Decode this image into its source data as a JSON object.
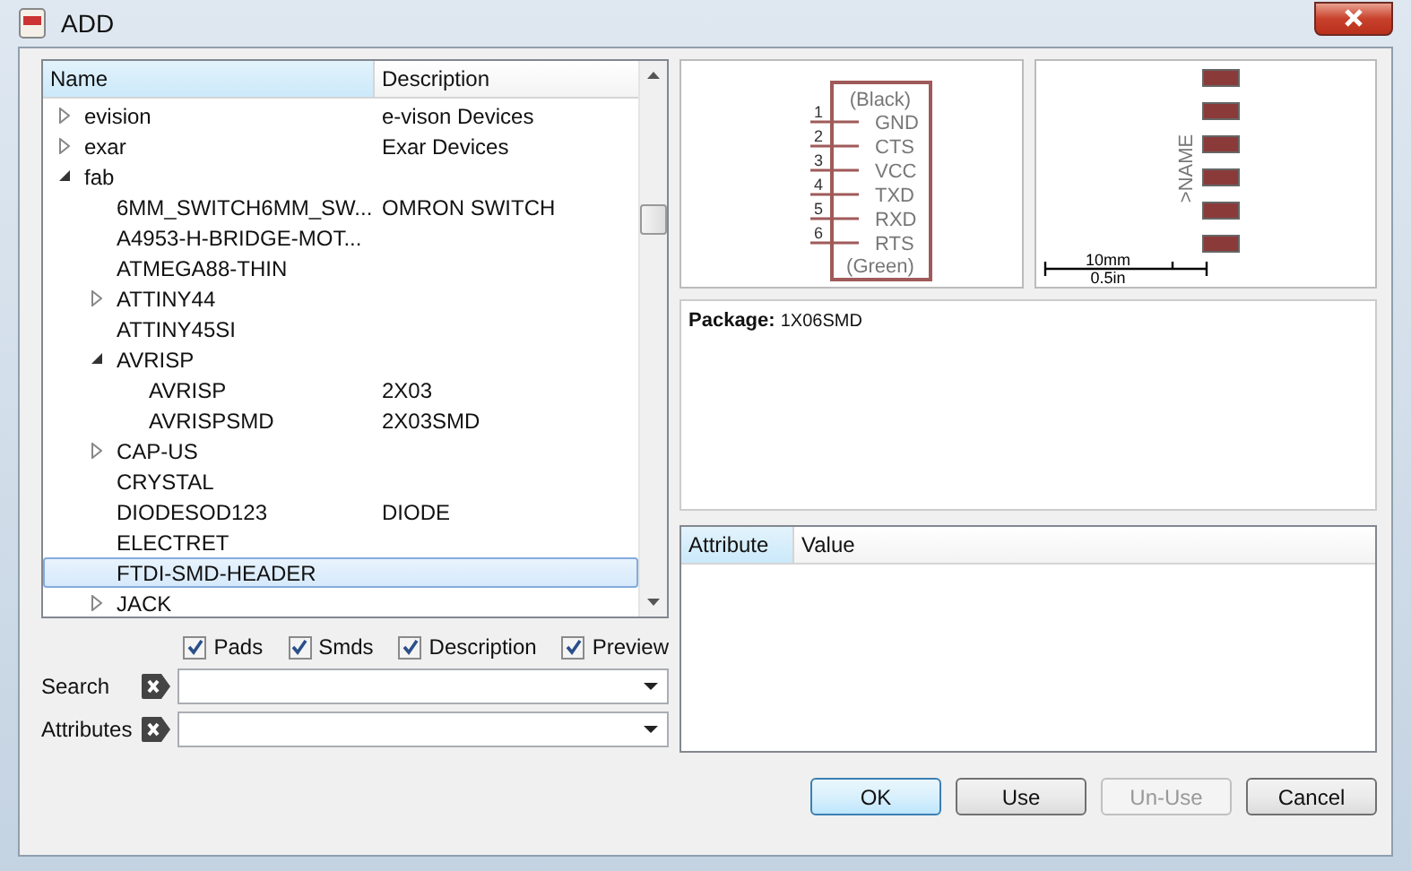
{
  "window": {
    "title": "ADD"
  },
  "tree": {
    "columns": [
      "Name",
      "Description"
    ],
    "items": [
      {
        "name": "evision",
        "description": "e-vison Devices",
        "expanded": false,
        "selected": false
      },
      {
        "name": "exar",
        "description": "Exar Devices",
        "expanded": false,
        "selected": false
      },
      {
        "name": "fab",
        "expanded": true,
        "selected": false,
        "children": [
          {
            "name": "6MM_SWITCH6MM_SW...",
            "description": "OMRON SWITCH",
            "selected": false
          },
          {
            "name": "A4953-H-BRIDGE-MOT...",
            "selected": false
          },
          {
            "name": "ATMEGA88-THIN",
            "selected": false
          },
          {
            "name": "ATTINY44",
            "expanded": false,
            "selected": false
          },
          {
            "name": "ATTINY45SI",
            "selected": false
          },
          {
            "name": "AVRISP",
            "expanded": true,
            "selected": false,
            "children": [
              {
                "name": "AVRISP",
                "description": "2X03",
                "selected": false
              },
              {
                "name": "AVRISPSMD",
                "description": "2X03SMD",
                "selected": false
              }
            ]
          },
          {
            "name": "CAP-US",
            "expanded": false,
            "selected": false
          },
          {
            "name": "CRYSTAL",
            "selected": false
          },
          {
            "name": "DIODESOD123",
            "description": "DIODE",
            "selected": false
          },
          {
            "name": "ELECTRET",
            "selected": false
          },
          {
            "name": "FTDI-SMD-HEADER",
            "selected": true
          },
          {
            "name": "JACK",
            "expanded": false,
            "selected": false
          }
        ]
      }
    ]
  },
  "filters": [
    {
      "label": "Pads",
      "checked": true
    },
    {
      "label": "Smds",
      "checked": true
    },
    {
      "label": "Description",
      "checked": true
    },
    {
      "label": "Preview",
      "checked": true
    }
  ],
  "search_fields": [
    {
      "label": "Search"
    },
    {
      "label": "Attributes"
    }
  ],
  "symbol": {
    "top_label": "(Black)",
    "bottom_label": "(Green)",
    "pins": [
      {
        "number": "1",
        "name": "GND"
      },
      {
        "number": "2",
        "name": "CTS"
      },
      {
        "number": "3",
        "name": "VCC"
      },
      {
        "number": "4",
        "name": "TXD"
      },
      {
        "number": "5",
        "name": "RXD"
      },
      {
        "number": "6",
        "name": "RTS"
      }
    ]
  },
  "package_preview": {
    "name_label": ">NAME",
    "scale_metric": "10mm",
    "scale_imperial": "0.5in"
  },
  "description": {
    "label": "Package:",
    "value": "1X06SMD"
  },
  "attributes": {
    "columns": [
      "Attribute",
      "Value"
    ]
  },
  "buttons": [
    {
      "label": "OK",
      "default": true,
      "disabled": false
    },
    {
      "label": "Use",
      "default": false,
      "disabled": false
    },
    {
      "label": "Un-Use",
      "default": false,
      "disabled": true
    },
    {
      "label": "Cancel",
      "default": false,
      "disabled": false
    }
  ]
}
